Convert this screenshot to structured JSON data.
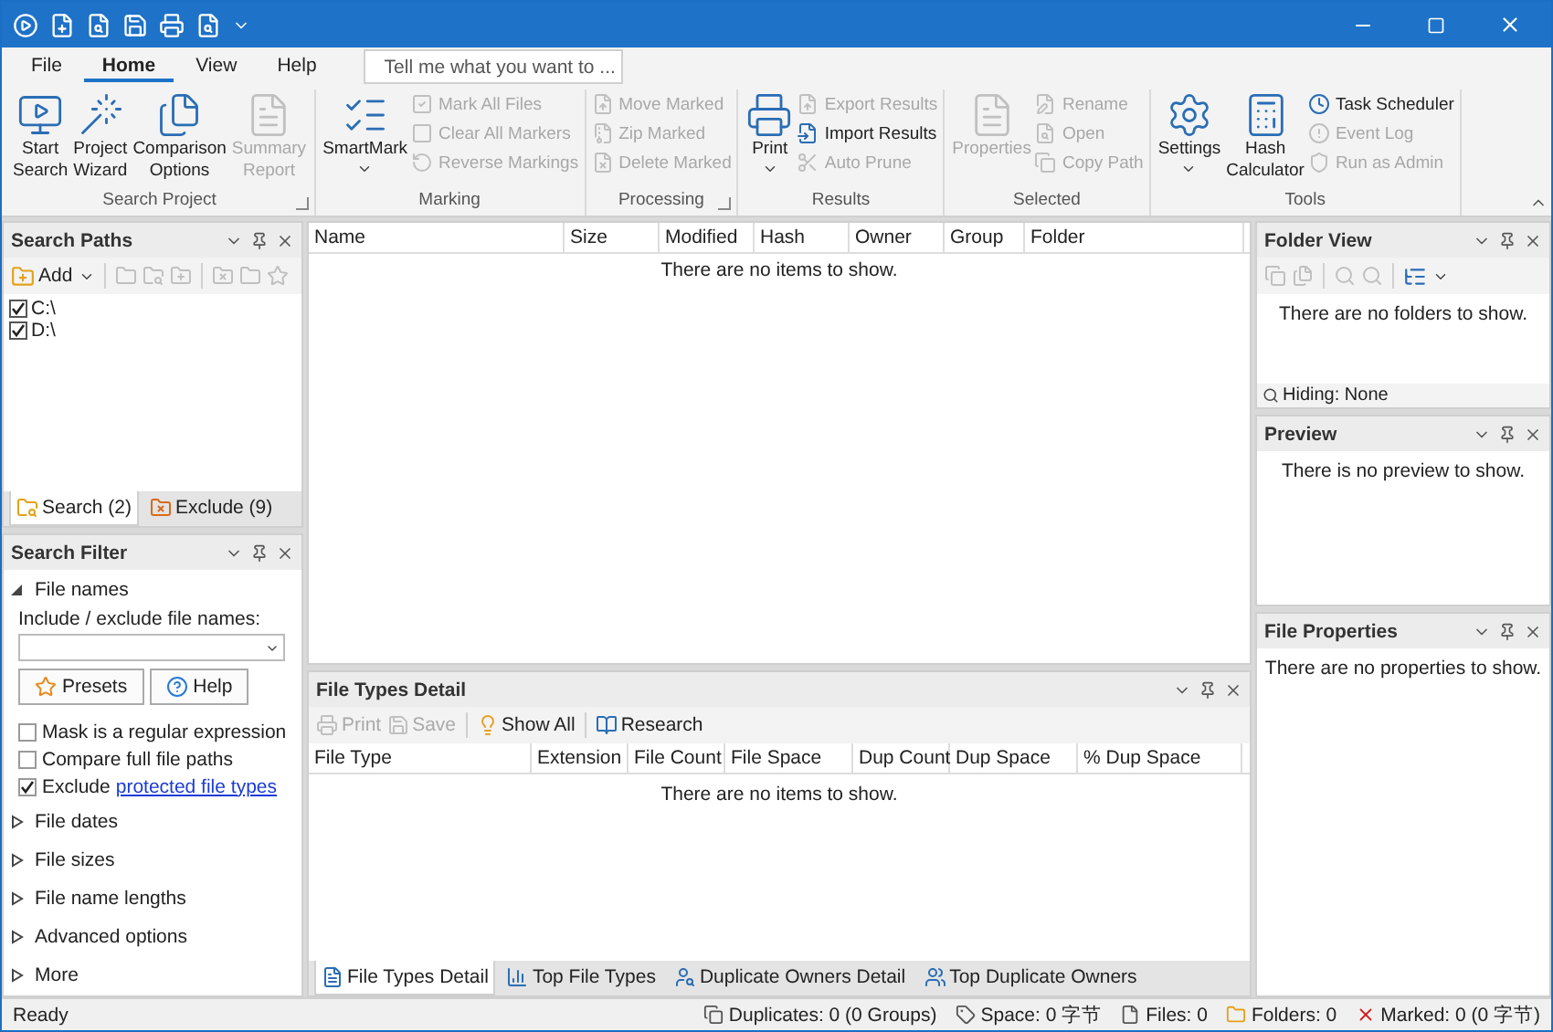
{
  "ribbon": {
    "tabs": [
      {
        "label": "File",
        "selected": false
      },
      {
        "label": "Home",
        "selected": true
      },
      {
        "label": "View",
        "selected": false
      },
      {
        "label": "Help",
        "selected": false
      }
    ],
    "search": {
      "placeholder": "Tell me what you want to ..."
    },
    "groups": [
      {
        "label": "Search Project",
        "launcher": true,
        "items": [
          {
            "kind": "large",
            "lines": [
              "Start",
              "Search"
            ],
            "disabled": false,
            "dropdown": false
          },
          {
            "kind": "large",
            "lines": [
              "Project",
              "Wizard"
            ],
            "disabled": false,
            "dropdown": false
          },
          {
            "kind": "large",
            "lines": [
              "Comparison",
              "Options"
            ],
            "disabled": false,
            "dropdown": false
          },
          {
            "kind": "large",
            "lines": [
              "Summary",
              "Report"
            ],
            "disabled": true,
            "dropdown": false
          }
        ]
      },
      {
        "label": "Marking",
        "launcher": false,
        "items": [
          {
            "kind": "large",
            "lines": [
              "SmartMark"
            ],
            "disabled": false,
            "dropdown": true
          },
          {
            "kind": "small",
            "lines": [
              "Mark All Files"
            ],
            "disabled": true
          },
          {
            "kind": "small",
            "lines": [
              "Clear All Markers"
            ],
            "disabled": true
          },
          {
            "kind": "small",
            "lines": [
              "Reverse Markings"
            ],
            "disabled": true
          }
        ]
      },
      {
        "label": "Processing",
        "launcher": true,
        "items": [
          {
            "kind": "small",
            "lines": [
              "Move Marked"
            ],
            "disabled": true
          },
          {
            "kind": "small",
            "lines": [
              "Zip Marked"
            ],
            "disabled": true
          },
          {
            "kind": "small",
            "lines": [
              "Delete Marked"
            ],
            "disabled": true
          }
        ]
      },
      {
        "label": "Results",
        "launcher": false,
        "items": [
          {
            "kind": "large",
            "lines": [
              "Print"
            ],
            "disabled": false,
            "dropdown": true
          },
          {
            "kind": "small",
            "lines": [
              "Export Results"
            ],
            "disabled": true
          },
          {
            "kind": "small",
            "lines": [
              "Import Results"
            ],
            "disabled": false
          },
          {
            "kind": "small",
            "lines": [
              "Auto Prune"
            ],
            "disabled": true
          }
        ]
      },
      {
        "label": "Selected",
        "launcher": false,
        "items": [
          {
            "kind": "large",
            "lines": [
              "Properties"
            ],
            "disabled": true,
            "dropdown": false
          },
          {
            "kind": "small",
            "lines": [
              "Rename"
            ],
            "disabled": true
          },
          {
            "kind": "small",
            "lines": [
              "Open"
            ],
            "disabled": true
          },
          {
            "kind": "small",
            "lines": [
              "Copy Path"
            ],
            "disabled": true
          }
        ]
      },
      {
        "label": "Tools",
        "launcher": false,
        "items": [
          {
            "kind": "large",
            "lines": [
              "Settings"
            ],
            "disabled": false,
            "dropdown": true
          },
          {
            "kind": "large",
            "lines": [
              "Hash",
              "Calculator"
            ],
            "disabled": false,
            "dropdown": false
          },
          {
            "kind": "small",
            "lines": [
              "Task Scheduler"
            ],
            "disabled": false
          },
          {
            "kind": "small",
            "lines": [
              "Event Log"
            ],
            "disabled": true
          },
          {
            "kind": "small",
            "lines": [
              "Run as Admin"
            ],
            "disabled": true
          }
        ]
      }
    ]
  },
  "search_paths": {
    "title": "Search Paths",
    "add_label": "Add",
    "paths": [
      {
        "label": "C:\\",
        "checked": true
      },
      {
        "label": "D:\\",
        "checked": true
      }
    ],
    "tabs": [
      {
        "label": "Search (2)",
        "selected": true
      },
      {
        "label": "Exclude (9)",
        "selected": false
      }
    ]
  },
  "search_filter": {
    "title": "Search Filter",
    "sections": [
      {
        "label": "File names",
        "expanded": true,
        "body": {
          "field_label": "Include / exclude file names:",
          "buttons": [
            "Presets",
            "Help"
          ],
          "options": [
            {
              "label": "Mask is a regular expression",
              "checked": false
            },
            {
              "label": "Compare full file paths",
              "checked": false
            },
            {
              "label": "Exclude",
              "link": "protected file types",
              "checked": true
            }
          ]
        }
      },
      {
        "label": "File dates",
        "expanded": false
      },
      {
        "label": "File sizes",
        "expanded": false
      },
      {
        "label": "File name lengths",
        "expanded": false
      },
      {
        "label": "Advanced options",
        "expanded": false
      },
      {
        "label": "More",
        "expanded": false
      }
    ]
  },
  "results_table": {
    "columns": [
      "Name",
      "Size",
      "Modified",
      "Hash",
      "Owner",
      "Group",
      "Folder"
    ],
    "empty_message": "There are no items to show."
  },
  "file_types_detail": {
    "title": "File Types Detail",
    "toolbar": [
      {
        "label": "Print",
        "disabled": true
      },
      {
        "label": "Save",
        "disabled": true
      },
      {
        "label": "Show All",
        "disabled": false
      },
      {
        "label": "Research",
        "disabled": false
      }
    ],
    "columns": [
      "File Type",
      "Extension",
      "File Count",
      "File Space",
      "Dup Count",
      "Dup Space",
      "% Dup Space"
    ],
    "empty_message": "There are no items to show.",
    "tabs": [
      {
        "label": "File Types Detail",
        "selected": true
      },
      {
        "label": "Top File Types",
        "selected": false
      },
      {
        "label": "Duplicate Owners Detail",
        "selected": false
      },
      {
        "label": "Top Duplicate Owners",
        "selected": false
      }
    ]
  },
  "folder_view": {
    "title": "Folder View",
    "empty_message": "There are no folders to show.",
    "footer": "Hiding: None"
  },
  "preview": {
    "title": "Preview",
    "empty_message": "There is no preview to show."
  },
  "file_properties": {
    "title": "File Properties",
    "empty_message": "There are no properties to show."
  },
  "status_bar": {
    "status": "Ready",
    "items": [
      "Duplicates: 0 (0 Groups)",
      "Space: 0 字节",
      "Files: 0",
      "Folders: 0",
      "Marked: 0 (0 字节)"
    ]
  }
}
